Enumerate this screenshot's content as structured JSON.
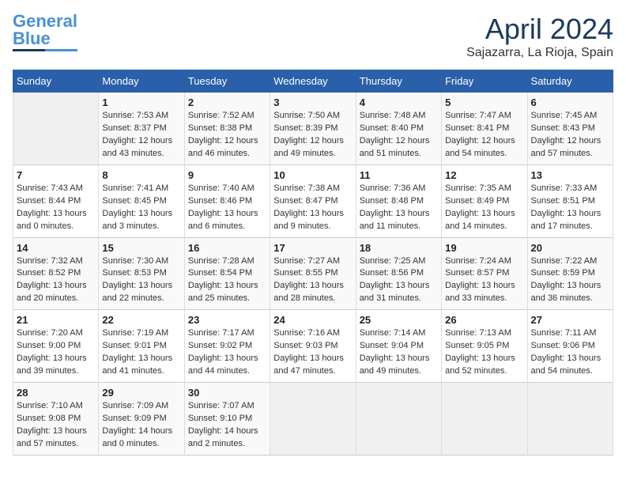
{
  "header": {
    "logo_line1": "General",
    "logo_line2": "Blue",
    "month": "April 2024",
    "location": "Sajazarra, La Rioja, Spain"
  },
  "weekdays": [
    "Sunday",
    "Monday",
    "Tuesday",
    "Wednesday",
    "Thursday",
    "Friday",
    "Saturday"
  ],
  "weeks": [
    [
      {
        "day": "",
        "info": ""
      },
      {
        "day": "1",
        "info": "Sunrise: 7:53 AM\nSunset: 8:37 PM\nDaylight: 12 hours\nand 43 minutes."
      },
      {
        "day": "2",
        "info": "Sunrise: 7:52 AM\nSunset: 8:38 PM\nDaylight: 12 hours\nand 46 minutes."
      },
      {
        "day": "3",
        "info": "Sunrise: 7:50 AM\nSunset: 8:39 PM\nDaylight: 12 hours\nand 49 minutes."
      },
      {
        "day": "4",
        "info": "Sunrise: 7:48 AM\nSunset: 8:40 PM\nDaylight: 12 hours\nand 51 minutes."
      },
      {
        "day": "5",
        "info": "Sunrise: 7:47 AM\nSunset: 8:41 PM\nDaylight: 12 hours\nand 54 minutes."
      },
      {
        "day": "6",
        "info": "Sunrise: 7:45 AM\nSunset: 8:43 PM\nDaylight: 12 hours\nand 57 minutes."
      }
    ],
    [
      {
        "day": "7",
        "info": "Sunrise: 7:43 AM\nSunset: 8:44 PM\nDaylight: 13 hours\nand 0 minutes."
      },
      {
        "day": "8",
        "info": "Sunrise: 7:41 AM\nSunset: 8:45 PM\nDaylight: 13 hours\nand 3 minutes."
      },
      {
        "day": "9",
        "info": "Sunrise: 7:40 AM\nSunset: 8:46 PM\nDaylight: 13 hours\nand 6 minutes."
      },
      {
        "day": "10",
        "info": "Sunrise: 7:38 AM\nSunset: 8:47 PM\nDaylight: 13 hours\nand 9 minutes."
      },
      {
        "day": "11",
        "info": "Sunrise: 7:36 AM\nSunset: 8:48 PM\nDaylight: 13 hours\nand 11 minutes."
      },
      {
        "day": "12",
        "info": "Sunrise: 7:35 AM\nSunset: 8:49 PM\nDaylight: 13 hours\nand 14 minutes."
      },
      {
        "day": "13",
        "info": "Sunrise: 7:33 AM\nSunset: 8:51 PM\nDaylight: 13 hours\nand 17 minutes."
      }
    ],
    [
      {
        "day": "14",
        "info": "Sunrise: 7:32 AM\nSunset: 8:52 PM\nDaylight: 13 hours\nand 20 minutes."
      },
      {
        "day": "15",
        "info": "Sunrise: 7:30 AM\nSunset: 8:53 PM\nDaylight: 13 hours\nand 22 minutes."
      },
      {
        "day": "16",
        "info": "Sunrise: 7:28 AM\nSunset: 8:54 PM\nDaylight: 13 hours\nand 25 minutes."
      },
      {
        "day": "17",
        "info": "Sunrise: 7:27 AM\nSunset: 8:55 PM\nDaylight: 13 hours\nand 28 minutes."
      },
      {
        "day": "18",
        "info": "Sunrise: 7:25 AM\nSunset: 8:56 PM\nDaylight: 13 hours\nand 31 minutes."
      },
      {
        "day": "19",
        "info": "Sunrise: 7:24 AM\nSunset: 8:57 PM\nDaylight: 13 hours\nand 33 minutes."
      },
      {
        "day": "20",
        "info": "Sunrise: 7:22 AM\nSunset: 8:59 PM\nDaylight: 13 hours\nand 36 minutes."
      }
    ],
    [
      {
        "day": "21",
        "info": "Sunrise: 7:20 AM\nSunset: 9:00 PM\nDaylight: 13 hours\nand 39 minutes."
      },
      {
        "day": "22",
        "info": "Sunrise: 7:19 AM\nSunset: 9:01 PM\nDaylight: 13 hours\nand 41 minutes."
      },
      {
        "day": "23",
        "info": "Sunrise: 7:17 AM\nSunset: 9:02 PM\nDaylight: 13 hours\nand 44 minutes."
      },
      {
        "day": "24",
        "info": "Sunrise: 7:16 AM\nSunset: 9:03 PM\nDaylight: 13 hours\nand 47 minutes."
      },
      {
        "day": "25",
        "info": "Sunrise: 7:14 AM\nSunset: 9:04 PM\nDaylight: 13 hours\nand 49 minutes."
      },
      {
        "day": "26",
        "info": "Sunrise: 7:13 AM\nSunset: 9:05 PM\nDaylight: 13 hours\nand 52 minutes."
      },
      {
        "day": "27",
        "info": "Sunrise: 7:11 AM\nSunset: 9:06 PM\nDaylight: 13 hours\nand 54 minutes."
      }
    ],
    [
      {
        "day": "28",
        "info": "Sunrise: 7:10 AM\nSunset: 9:08 PM\nDaylight: 13 hours\nand 57 minutes."
      },
      {
        "day": "29",
        "info": "Sunrise: 7:09 AM\nSunset: 9:09 PM\nDaylight: 14 hours\nand 0 minutes."
      },
      {
        "day": "30",
        "info": "Sunrise: 7:07 AM\nSunset: 9:10 PM\nDaylight: 14 hours\nand 2 minutes."
      },
      {
        "day": "",
        "info": ""
      },
      {
        "day": "",
        "info": ""
      },
      {
        "day": "",
        "info": ""
      },
      {
        "day": "",
        "info": ""
      }
    ]
  ]
}
